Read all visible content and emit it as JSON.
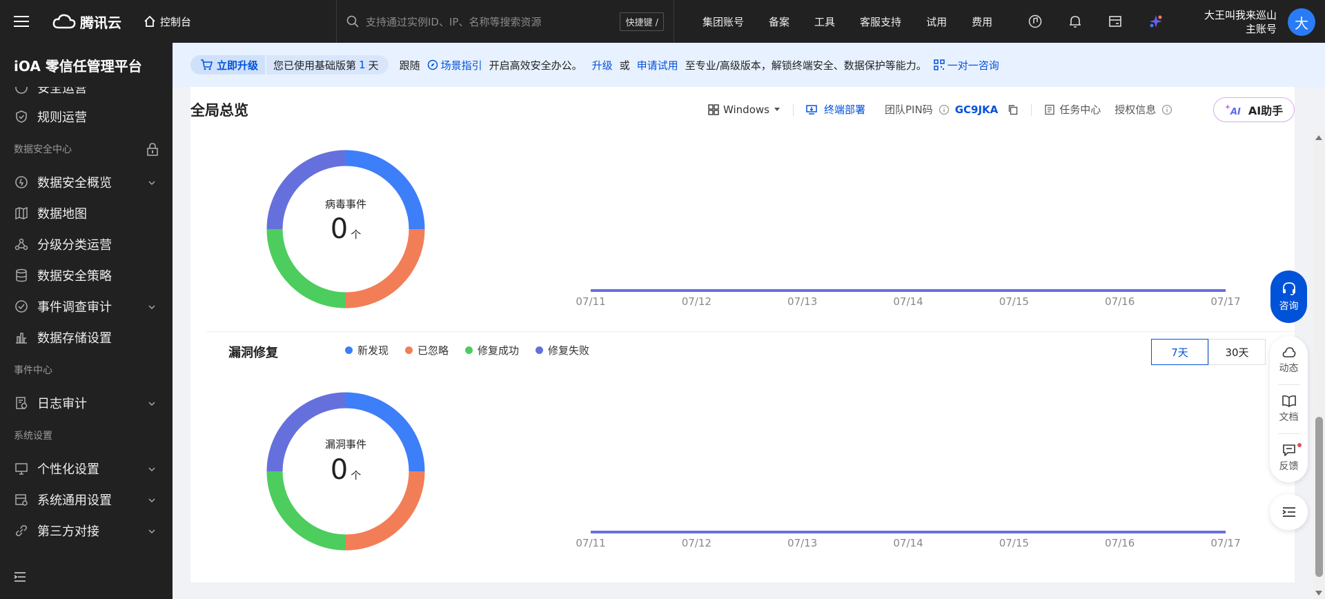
{
  "topbar": {
    "logo_text": "腾讯云",
    "console": "控制台",
    "search_placeholder": "支持通过实例ID、IP、名称等搜索资源",
    "shortcut": "快捷键 /",
    "nav": [
      "集团账号",
      "备案",
      "工具",
      "客服支持",
      "试用",
      "费用"
    ],
    "user_name": "大王叫我来巡山",
    "user_role": "主账号",
    "avatar": "大"
  },
  "sidebar": {
    "title": "iOA 零信任管理平台",
    "cut_item": "安全运营",
    "items_top": [
      {
        "label": "规则运营",
        "icon": "shield-icon"
      }
    ],
    "group_data_security": "数据安全中心",
    "data_items": [
      {
        "label": "数据安全概览",
        "icon": "gauge-icon",
        "chevron": true
      },
      {
        "label": "数据地图",
        "icon": "map-icon",
        "chevron": false
      },
      {
        "label": "分级分类运营",
        "icon": "nodes-icon",
        "chevron": false
      },
      {
        "label": "数据安全策略",
        "icon": "database-icon",
        "chevron": false
      },
      {
        "label": "事件调查审计",
        "icon": "check-circle-icon",
        "chevron": true
      },
      {
        "label": "数据存储设置",
        "icon": "storage-icon",
        "chevron": false
      }
    ],
    "group_event": "事件中心",
    "event_items": [
      {
        "label": "日志审计",
        "icon": "log-icon",
        "chevron": true
      }
    ],
    "group_system": "系统设置",
    "system_items": [
      {
        "label": "个性化设置",
        "icon": "monitor-icon",
        "chevron": true
      },
      {
        "label": "系统通用设置",
        "icon": "settings-icon",
        "chevron": true
      },
      {
        "label": "第三方对接",
        "icon": "link-icon",
        "chevron": true
      }
    ]
  },
  "banner": {
    "upgrade_btn": "立即升级",
    "used_prefix": "您已使用基础版第",
    "used_day": "1",
    "used_suffix": "天",
    "follow": "跟随",
    "scene_guide": "场景指引",
    "start_text": "开启高效安全办公。",
    "upgrade_link": "升级",
    "or": "或",
    "apply_trial": "申请试用",
    "pro_text": "至专业/高级版本，解锁终端安全、数据保护等能力。",
    "one_on_one": "一对一咨询"
  },
  "header": {
    "title": "全局总览",
    "os": "Windows",
    "deploy": "终端部署",
    "pin_label": "团队PIN码",
    "pin_value": "GC9JKA",
    "task_center": "任务中心",
    "license_info": "授权信息",
    "ai_btn": "AI助手"
  },
  "virus_panel": {
    "donut_label": "病毒事件",
    "count": "0",
    "unit": "个"
  },
  "vuln_panel": {
    "title": "漏洞修复",
    "legend": [
      "新发现",
      "已忽略",
      "修复成功",
      "修复失败"
    ],
    "range_7": "7天",
    "range_30": "30天",
    "donut_label": "漏洞事件",
    "count": "0",
    "unit": "个"
  },
  "colors": {
    "blue": "#3d7ef9",
    "orange": "#f27e57",
    "green": "#4ccd5e",
    "purple": "#6670dd",
    "brand": "#0052d9"
  },
  "chart_data": [
    {
      "type": "line",
      "x": [
        "07/11",
        "07/12",
        "07/13",
        "07/14",
        "07/15",
        "07/16",
        "07/17"
      ],
      "series": [
        {
          "values": [
            0,
            0,
            0,
            0,
            0,
            0,
            0
          ]
        }
      ]
    },
    {
      "type": "line",
      "x": [
        "07/11",
        "07/12",
        "07/13",
        "07/14",
        "07/15",
        "07/16",
        "07/17"
      ],
      "series": [
        {
          "values": [
            0,
            0,
            0,
            0,
            0,
            0,
            0
          ]
        }
      ]
    }
  ],
  "tools": {
    "consult": "咨询",
    "dynamic": "动态",
    "docs": "文档",
    "feedback": "反馈"
  }
}
